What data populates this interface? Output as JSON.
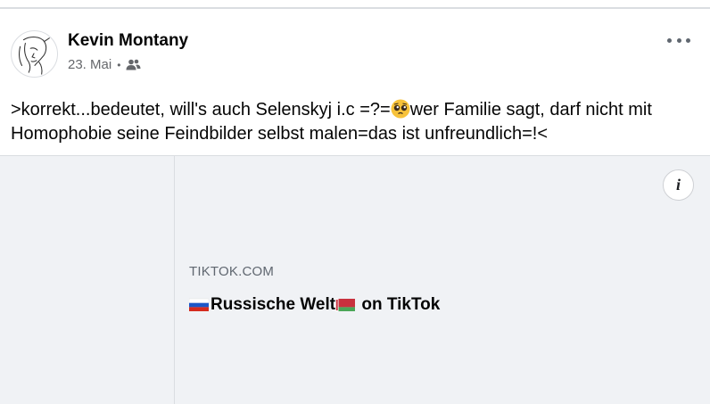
{
  "post": {
    "author": "Kevin Montany",
    "date": "23. Mai",
    "separator": "•",
    "audience_icon": "friends-icon",
    "text_part1": ">korrekt...bedeutet, will's auch Selenskyj i.c =?=",
    "text_emoji": "pleading-face-emoji",
    "text_part2": "wer Familie sagt, darf nicht mit Homophobie seine Feindbilder selbst malen=das ist unfreundlich=!<"
  },
  "link_preview": {
    "domain": "TIKTOK.COM",
    "title_flag_1": "russia-flag-icon",
    "title_main": "Russische Welt",
    "title_flag_2": "belarus-flag-icon",
    "title_suffix": " on TikTok",
    "info_label": "i"
  },
  "colors": {
    "background": "#ffffff",
    "card_background": "#f0f2f5",
    "secondary_text": "#65676b",
    "divider": "#dadde1"
  }
}
